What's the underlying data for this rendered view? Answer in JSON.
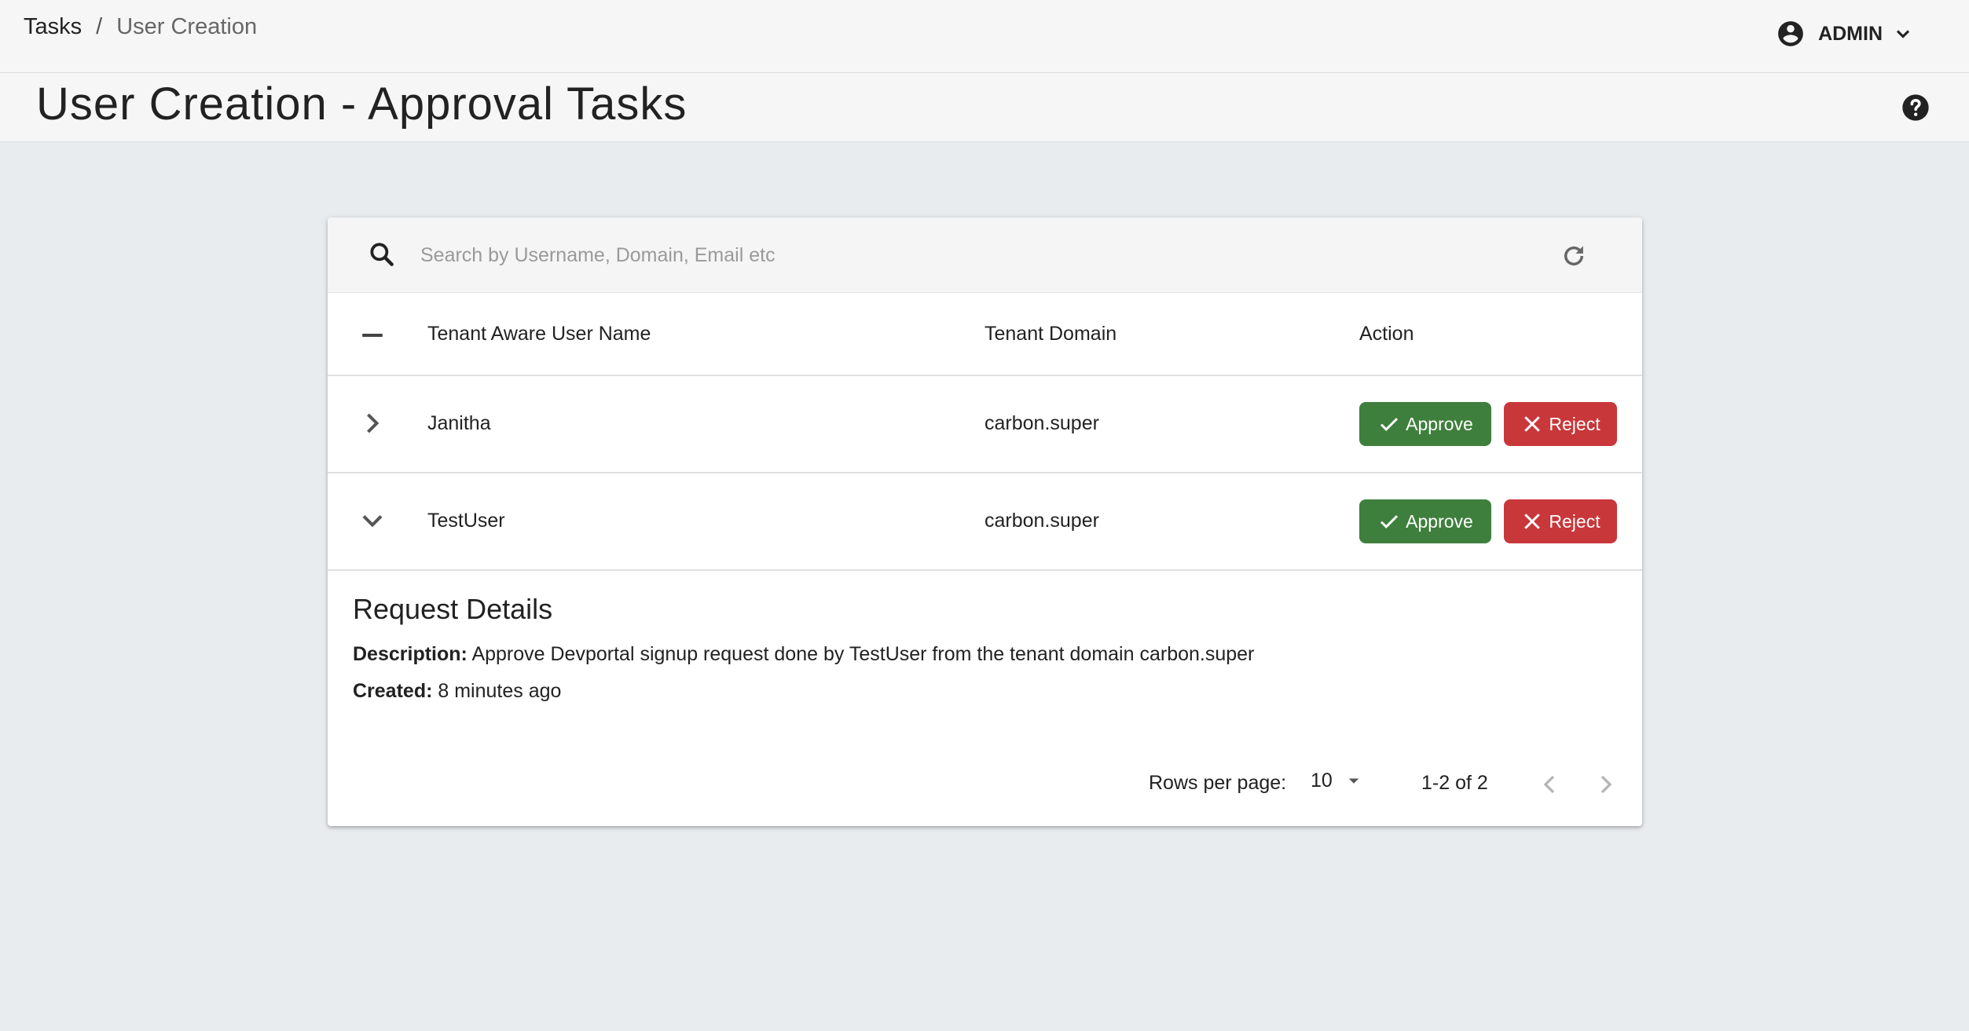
{
  "breadcrumb": {
    "root": "Tasks",
    "separator": "/",
    "current": "User Creation"
  },
  "user": {
    "name": "ADMIN"
  },
  "page": {
    "title": "User Creation - Approval Tasks"
  },
  "search": {
    "placeholder": "Search by Username, Domain, Email etc",
    "value": ""
  },
  "table": {
    "columns": [
      "Tenant Aware User Name",
      "Tenant Domain",
      "Action"
    ],
    "rows": [
      {
        "username": "Janitha",
        "domain": "carbon.super",
        "expanded": false,
        "approve_label": "Approve",
        "reject_label": "Reject"
      },
      {
        "username": "TestUser",
        "domain": "carbon.super",
        "expanded": true,
        "approve_label": "Approve",
        "reject_label": "Reject"
      }
    ]
  },
  "details": {
    "title": "Request Details",
    "description_label": "Description:",
    "description": "Approve Devportal signup request done by TestUser from the tenant domain carbon.super",
    "created_label": "Created:",
    "created": "8 minutes ago"
  },
  "pagination": {
    "rows_per_page_label": "Rows per page:",
    "rows_per_page": "10",
    "range": "1-2 of 2"
  },
  "colors": {
    "approve": "#3f7f3d",
    "reject": "#c8373a",
    "background": "#e9ecef"
  },
  "icons": [
    "account-circle-icon",
    "chevron-down-icon",
    "help-icon",
    "search-icon",
    "refresh-icon",
    "collapse-all-icon",
    "chevron-right-icon",
    "check-icon",
    "close-icon",
    "dropdown-arrow-icon",
    "chevron-left-icon"
  ]
}
